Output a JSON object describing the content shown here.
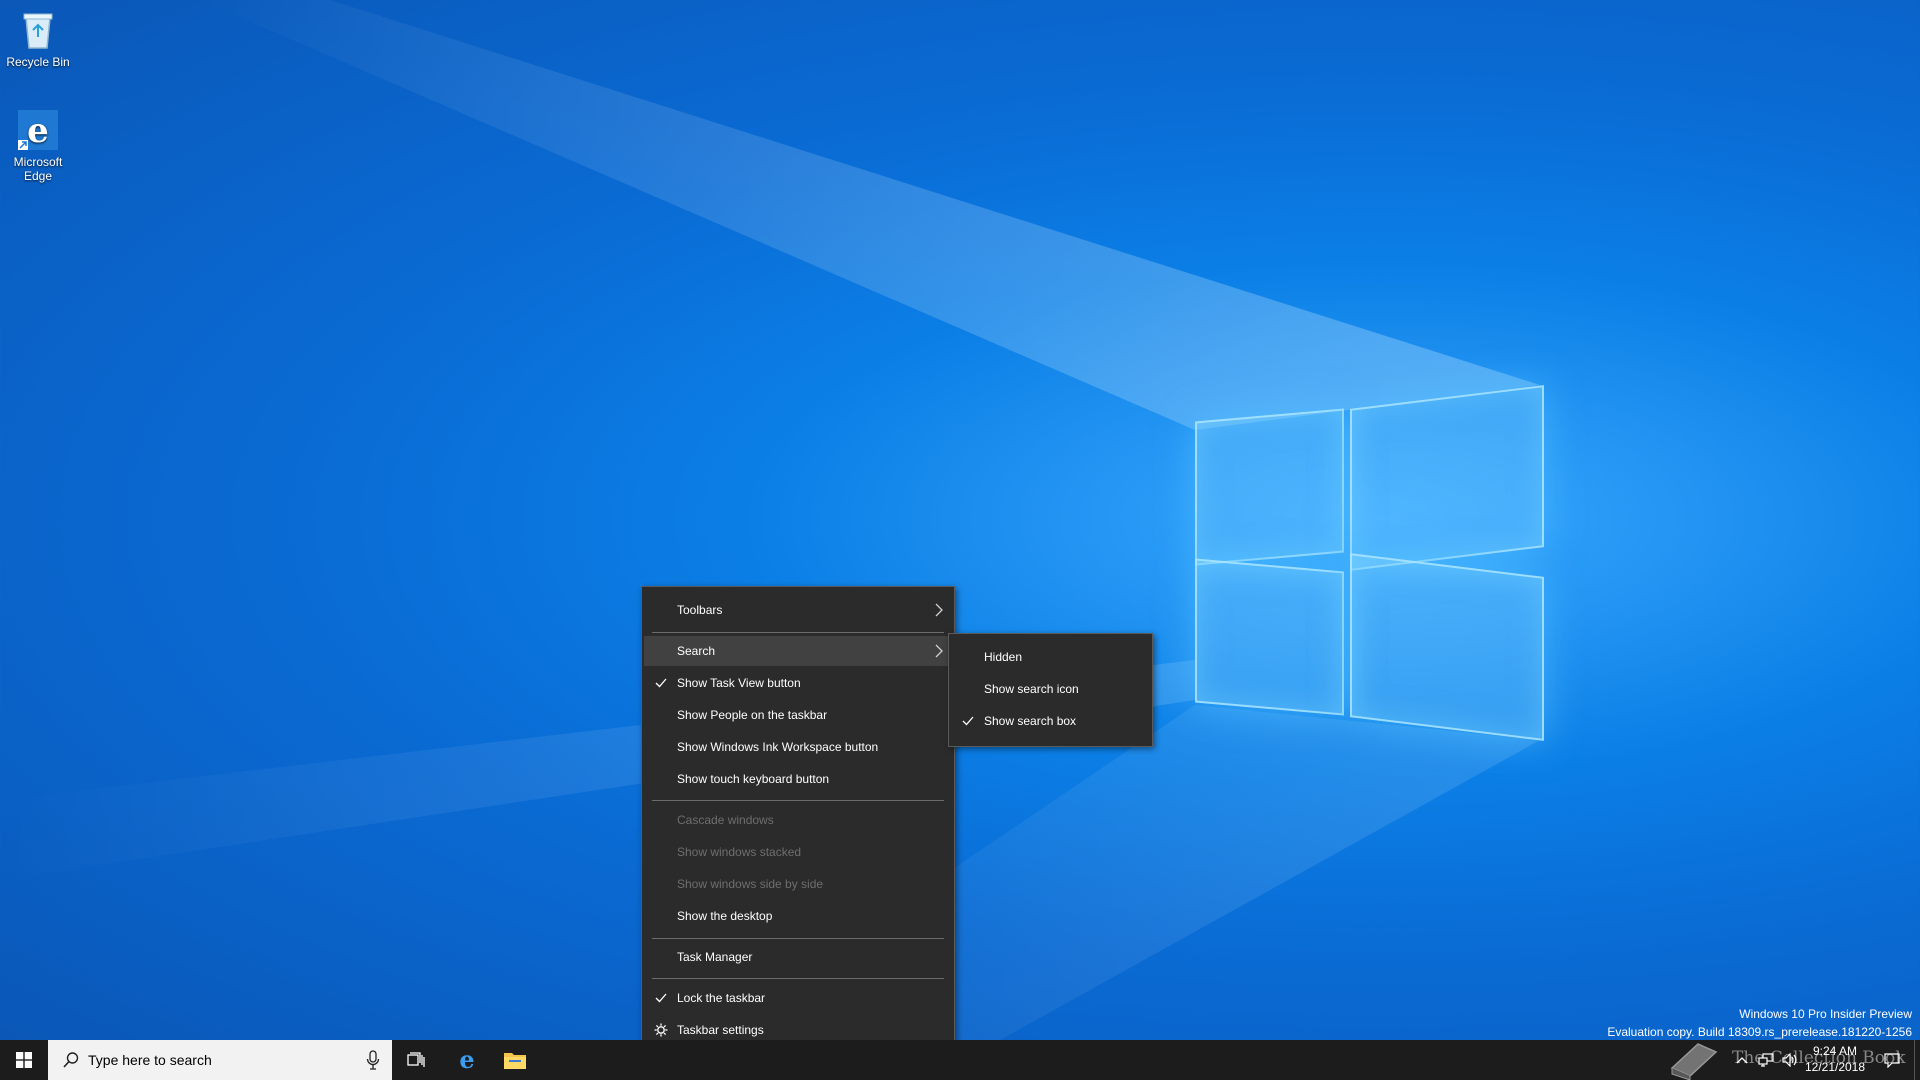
{
  "desktop": {
    "icons": [
      {
        "label": "Recycle Bin",
        "icon": "recycle-bin-icon"
      },
      {
        "label": "Microsoft Edge",
        "icon": "edge-icon"
      }
    ],
    "watermark": {
      "line1": "Windows 10 Pro Insider Preview",
      "line2": "Evaluation copy. Build 18309.rs_prerelease.181220-1256"
    },
    "overlay_brand": "The Collection Book"
  },
  "context_menu": {
    "items": [
      {
        "label": "Toolbars",
        "submenu": true
      },
      {
        "label": "Search",
        "submenu": true,
        "highlighted": true
      },
      {
        "label": "Show Task View button",
        "checked": true
      },
      {
        "label": "Show People on the taskbar"
      },
      {
        "label": "Show Windows Ink Workspace button"
      },
      {
        "label": "Show touch keyboard button"
      },
      {
        "label": "Cascade windows",
        "disabled": true
      },
      {
        "label": "Show windows stacked",
        "disabled": true
      },
      {
        "label": "Show windows side by side",
        "disabled": true
      },
      {
        "label": "Show the desktop"
      },
      {
        "label": "Task Manager"
      },
      {
        "label": "Lock the taskbar",
        "checked": true
      },
      {
        "label": "Taskbar settings",
        "icon": "gear-icon"
      }
    ]
  },
  "search_submenu": {
    "items": [
      {
        "label": "Hidden"
      },
      {
        "label": "Show search icon"
      },
      {
        "label": "Show search box",
        "checked": true
      }
    ]
  },
  "taskbar": {
    "search_placeholder": "Type here to search",
    "pinned": [
      "task-view-icon",
      "edge-icon",
      "file-explorer-icon"
    ],
    "clock": {
      "time": "9:24 AM",
      "date": "12/21/2018"
    }
  },
  "colors": {
    "menu_bg": "#2b2b2b",
    "menu_hover": "#414141",
    "taskbar_bg": "#1c1c1c",
    "desktop_blue": "#0a6bd4"
  }
}
